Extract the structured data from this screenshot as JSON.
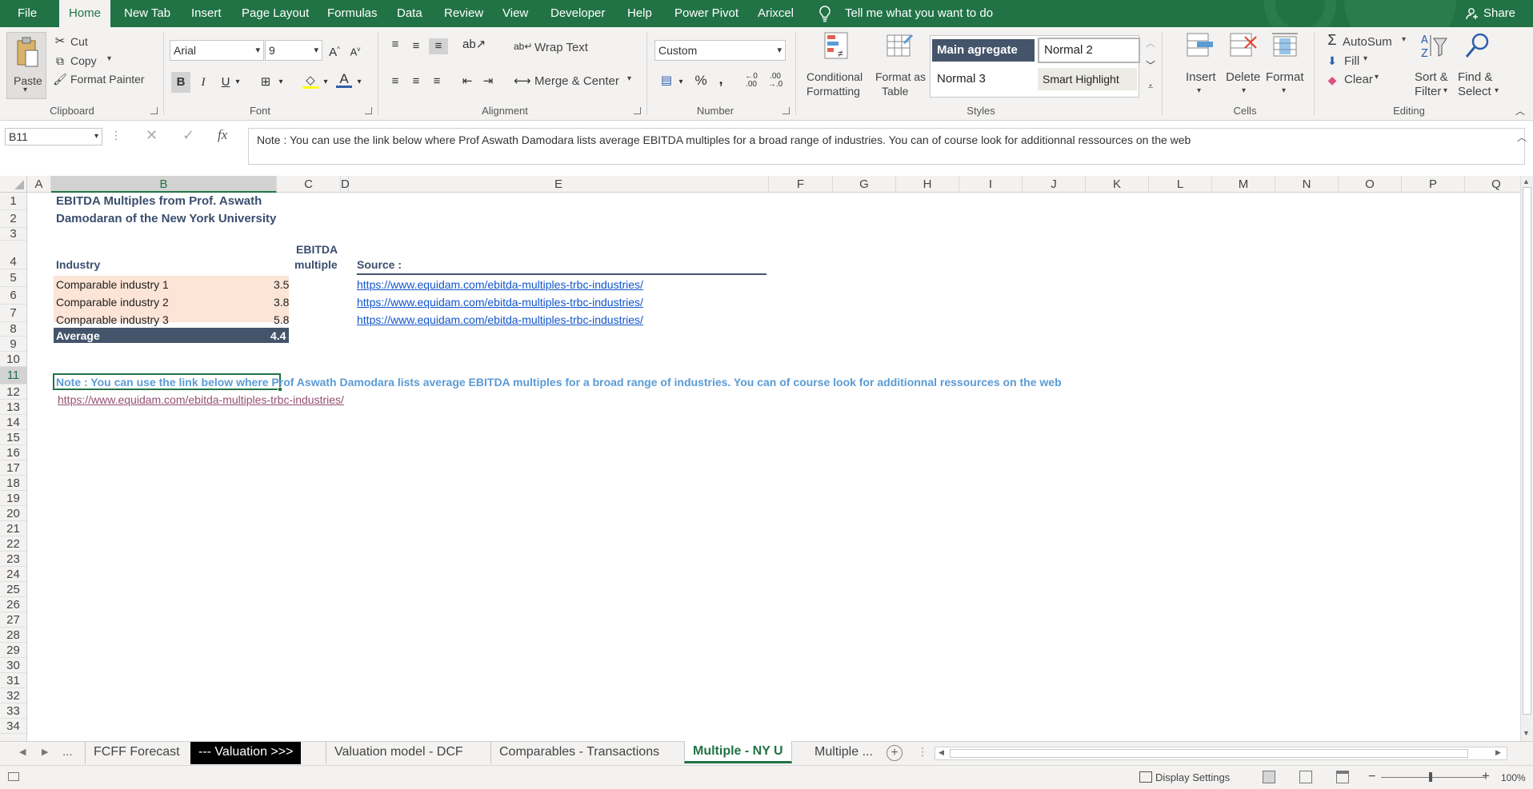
{
  "menu": {
    "tabs": [
      "File",
      "Home",
      "New Tab",
      "Insert",
      "Page Layout",
      "Formulas",
      "Data",
      "Review",
      "View",
      "Developer",
      "Help",
      "Power Pivot",
      "Arixcel"
    ],
    "tell_me": "Tell me what you want to do",
    "share": "Share"
  },
  "ribbon": {
    "clipboard": {
      "paste": "Paste",
      "cut": "Cut",
      "copy": "Copy",
      "format_painter": "Format Painter",
      "label": "Clipboard"
    },
    "font": {
      "name": "Arial",
      "size": "9",
      "label": "Font",
      "bold": "B",
      "italic": "I",
      "underline": "U"
    },
    "alignment": {
      "wrap": "Wrap Text",
      "merge": "Merge & Center",
      "label": "Alignment"
    },
    "number": {
      "format": "Custom",
      "percent": "%",
      "comma": ",",
      "label": "Number"
    },
    "styles": {
      "cond1": "Conditional",
      "cond2": "Formatting",
      "fmt1": "Format as",
      "fmt2": "Table",
      "gallery": [
        "Main agregate",
        "Normal 2",
        "Normal 3",
        "Smart Highlight"
      ],
      "label": "Styles"
    },
    "cells": {
      "insert": "Insert",
      "delete": "Delete",
      "format": "Format",
      "label": "Cells"
    },
    "editing": {
      "autosum": "AutoSum",
      "fill": "Fill",
      "clear": "Clear",
      "sort1": "Sort &",
      "sort2": "Filter",
      "find1": "Find &",
      "find2": "Select",
      "label": "Editing"
    }
  },
  "formula_bar": {
    "name_box": "B11",
    "fx": "fx",
    "content": "Note : You can use the link below where Prof Aswath Damodara lists average EBITDA multiples for a broad range of industries. You can of course look for additionnal ressources on the web"
  },
  "grid": {
    "columns": [
      "A",
      "B",
      "C",
      "D",
      "E",
      "F",
      "G",
      "H",
      "I",
      "J",
      "K",
      "L",
      "M",
      "N",
      "O",
      "P",
      "Q"
    ],
    "rows": [
      "1",
      "2",
      "3",
      "4",
      "5",
      "6",
      "7",
      "8",
      "9",
      "10",
      "11",
      "12",
      "13",
      "14",
      "15",
      "16",
      "17",
      "18",
      "19",
      "20",
      "21",
      "22",
      "23",
      "24",
      "25",
      "26",
      "27",
      "28",
      "29",
      "30",
      "31",
      "32",
      "33",
      "34"
    ],
    "selected_col": "B",
    "selected_row": "11"
  },
  "sheet": {
    "title1": "EBITDA Multiples from Prof. Aswath",
    "title2": "Damodaran of the New York University",
    "hdr_industry": "Industry",
    "hdr_ebitda1": "EBITDA",
    "hdr_ebitda2": "multiple",
    "hdr_source": "Source :",
    "rows": [
      {
        "industry": "Comparable industry 1",
        "multiple": "3.5",
        "source": "https://www.equidam.com/ebitda-multiples-trbc-industries/"
      },
      {
        "industry": "Comparable industry 2",
        "multiple": "3.8",
        "source": "https://www.equidam.com/ebitda-multiples-trbc-industries/"
      },
      {
        "industry": "Comparable industry 3",
        "multiple": "5.8",
        "source": "https://www.equidam.com/ebitda-multiples-trbc-industries/"
      }
    ],
    "avg_label": "Average",
    "avg_value": "4.4",
    "note": "Note : You can use the link below where Prof Aswath Damodara lists average EBITDA multiples for a broad range of industries. You can of course look for additionnal ressources on the web",
    "note_link": "https://www.equidam.com/ebitda-multiples-trbc-industries/"
  },
  "sheet_tabs": {
    "ellipsis": "...",
    "tabs": [
      "FCFF Forecast",
      "--- Valuation >>>",
      "Valuation model - DCF",
      "Comparables - Transactions",
      "Multiple - NY U",
      "Multiple ..."
    ]
  },
  "status": {
    "display_settings": "Display Settings",
    "zoom": "100%"
  },
  "colors": {
    "excel_green": "#217346",
    "table_fill": "#fce4d6",
    "avg_fill": "#44546a",
    "note_blue": "#5b9bd5",
    "link_visited": "#954f72"
  }
}
